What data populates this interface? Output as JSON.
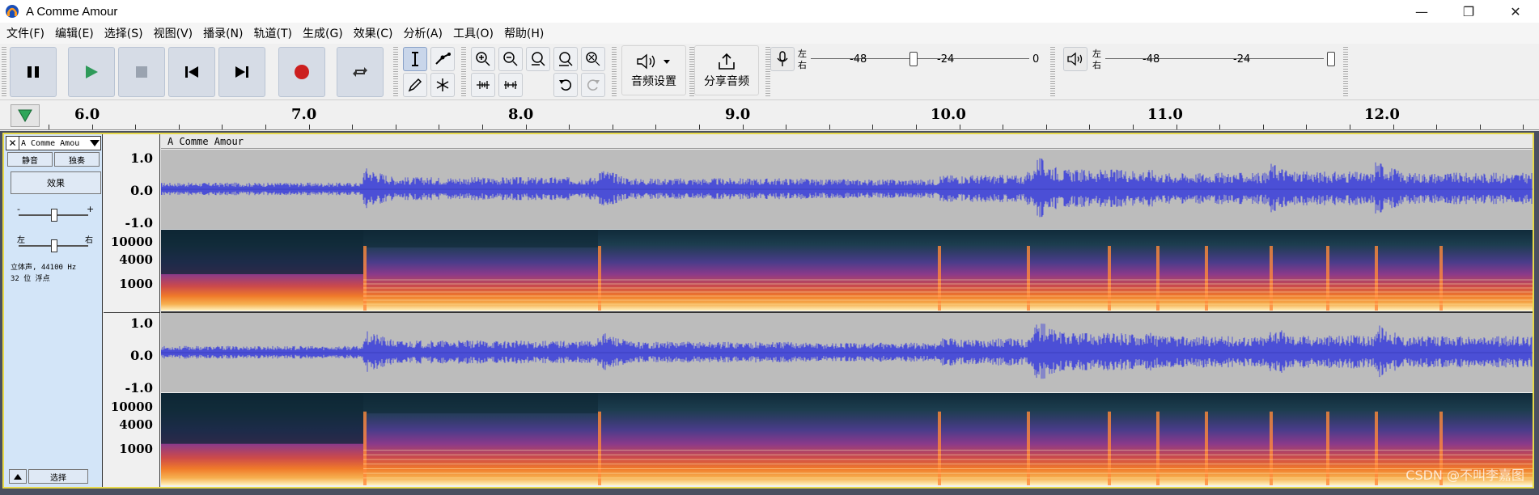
{
  "window": {
    "title": "A Comme Amour",
    "minimize": "—",
    "maximize": "❐",
    "close": "✕"
  },
  "menu": [
    "文件(F)",
    "编辑(E)",
    "选择(S)",
    "视图(V)",
    "播录(N)",
    "轨道(T)",
    "生成(G)",
    "效果(C)",
    "分析(A)",
    "工具(O)",
    "帮助(H)"
  ],
  "toolbar": {
    "audio_setup_label": "音频设置",
    "share_audio_label": "分享音频",
    "rec_meter": {
      "lr_top": "左",
      "lr_bottom": "右",
      "marks": [
        "-48",
        "-24",
        "0"
      ]
    },
    "play_meter": {
      "lr_top": "左",
      "lr_bottom": "右",
      "marks": [
        "-48",
        "-24"
      ]
    }
  },
  "ruler": {
    "labels": [
      "6.0",
      "7.0",
      "8.0",
      "9.0",
      "10.0",
      "11.0",
      "12.0"
    ]
  },
  "track": {
    "name": "A Comme Amou",
    "clip_name": "A Comme Amour",
    "mute_label": "静音",
    "solo_label": "独奏",
    "effects_label": "效果",
    "gain_minus": "-",
    "gain_plus": "+",
    "pan_left": "左",
    "pan_right": "右",
    "info_line1": "立体声, 44100 Hz",
    "info_line2": "32 位 浮点",
    "select_label": "选择"
  },
  "channels": [
    {
      "wave_scale": [
        "1.0",
        "0.0",
        "-1.0"
      ],
      "spec_scale": [
        "10000",
        "4000",
        "1000"
      ]
    },
    {
      "wave_scale": [
        "1.0",
        "0.0",
        "-1.0"
      ],
      "spec_scale": [
        "10000",
        "4000",
        "1000"
      ]
    }
  ],
  "watermark": "CSDN @不叫李嘉图",
  "colors": {
    "waveform": "#4b4fd6",
    "track_bg": "#bcbcbc",
    "panel_bg": "#d3e5f8",
    "selection_border": "#e7d94a"
  }
}
